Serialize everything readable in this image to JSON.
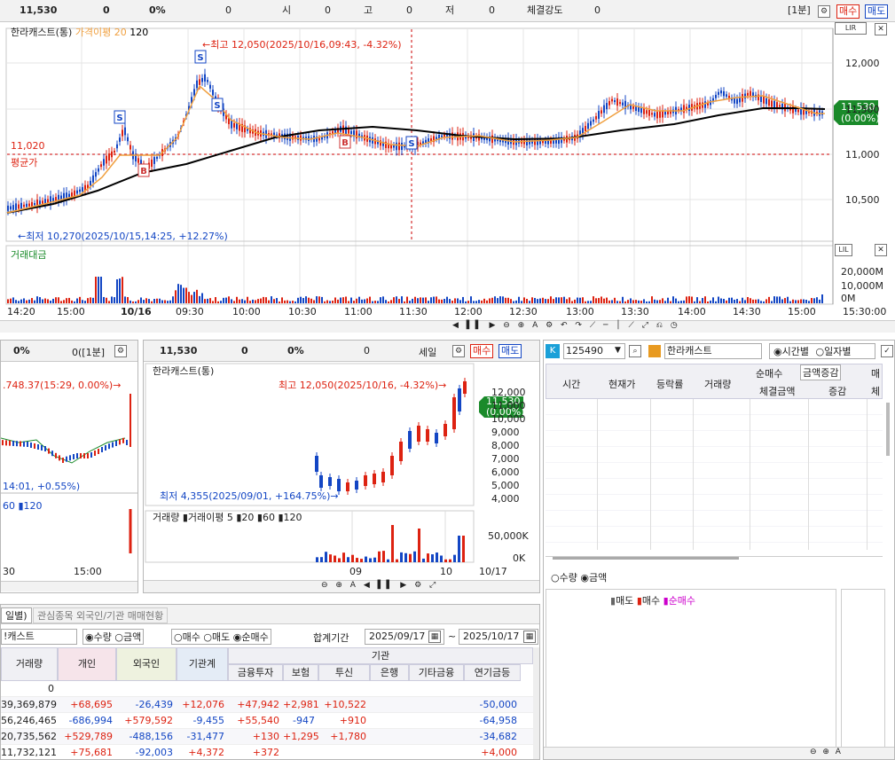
{
  "top_bar": {
    "price": "11,530",
    "change": "0",
    "rate": "0%",
    "volume": "0",
    "open_label": "시",
    "open": "0",
    "high_label": "고",
    "high": "0",
    "low_label": "저",
    "low": "0",
    "strength_label": "체결강도",
    "strength": "0",
    "interval": "[1분]",
    "buy": "매수",
    "sell": "매도"
  },
  "main_chart": {
    "legend_name": "한라캐스트(통)",
    "legend_ma": "가격이평 20",
    "legend_120": "120",
    "high_annotation": "←최고 12,050(2025/10/16,09:43, -4.32%)",
    "low_annotation": "←최저 10,270(2025/10/15,14:25, +12.27%)",
    "avg_price": "11,020",
    "avg_label": "평균가",
    "current_price": "11,530",
    "current_rate": "(0.00%)",
    "y_labels": [
      "12,000",
      "11,500",
      "11,000",
      "10,500"
    ],
    "vol_label": "거래대금",
    "vol_y_labels": [
      "20,000M",
      "10,000M",
      "0M"
    ],
    "x_labels": [
      "14:20",
      "15:00",
      "10/16",
      "09:30",
      "10:00",
      "10:30",
      "11:00",
      "11:30",
      "12:00",
      "12:30",
      "13:00",
      "13:30",
      "14:00",
      "14:30",
      "15:00",
      "15:30:00"
    ],
    "lir": "LIR",
    "lil": "LIL"
  },
  "left_panel": {
    "rate": "0%",
    "interval": "0([1분]",
    "annotation": ".748.37(15:29, 0.00%)→",
    "low_annotation": "14:01, +0.55%)",
    "legend": "60 ▮120",
    "x_labels": [
      "30",
      "15:00"
    ]
  },
  "mid_panel": {
    "price": "11,530",
    "change": "0",
    "rate": "0%",
    "volume": "0",
    "interval": "세일",
    "buy": "매수",
    "sell": "매도",
    "legend_name": "한라캐스트(통)",
    "high_annotation": "최고 12,050(2025/10/16, -4.32%)→",
    "low_annotation": "최저 4,355(2025/09/01, +164.75%)→",
    "current_price": "11,530",
    "current_rate": "(0.00%)",
    "y_labels": [
      "12,000",
      "11,000",
      "10,000",
      "9,000",
      "8,000",
      "7,000",
      "6,000",
      "5,000",
      "4,000"
    ],
    "vol_legend": "거래량 ▮거래이평 5 ▮20 ▮60 ▮120",
    "vol_y_labels": [
      "50,000K",
      "0K"
    ],
    "x_labels": [
      "09",
      "10",
      "10/17"
    ]
  },
  "right_panel": {
    "code": "125490",
    "name": "한라캐스트",
    "radio_time": "시간별",
    "radio_day": "일자별",
    "cols": [
      "시간",
      "현재가",
      "등락률",
      "거래량"
    ],
    "net_buy_label": "순매수",
    "amount_change": "금액증감",
    "buy_short": "매",
    "sub_cols": [
      "체결금액",
      "증감",
      "체"
    ],
    "radio_qty": "수량",
    "radio_amt": "금액",
    "legend_sell": "매도",
    "legend_buy": "매수",
    "legend_net": "순매수"
  },
  "bottom_panel": {
    "tab_left": "일별)",
    "tab_right": "관심종목 외국인/기관 매매현황",
    "name": "!캐스트",
    "radio_qty": "수량",
    "radio_amt": "금액",
    "radio_buy": "매수",
    "radio_sell": "매도",
    "radio_net": "순매수",
    "period_label": "합계기간",
    "date_from": "2025/09/17",
    "tilde": "~",
    "date_to": "2025/10/17",
    "headers": [
      "거래량",
      "개인",
      "외국인",
      "기관계",
      "금융투자",
      "보험",
      "투신",
      "은행",
      "기타금융",
      "연기금등"
    ],
    "inst_label": "기관",
    "rows": [
      [
        "0",
        "",
        "",
        "",
        "",
        "",
        "",
        "",
        "",
        ""
      ],
      [
        "39,369,879",
        "+68,695",
        "-26,439",
        "+12,076",
        "+47,942",
        "+2,981",
        "+10,522",
        "",
        "",
        "-50,000"
      ],
      [
        "56,246,465",
        "-686,994",
        "+579,592",
        "-9,455",
        "+55,540",
        "-947",
        "+910",
        "",
        "",
        "-64,958"
      ],
      [
        "20,735,562",
        "+529,789",
        "-488,156",
        "-31,477",
        "+130",
        "+1,295",
        "+1,780",
        "",
        "",
        "-34,682"
      ],
      [
        "11,732,121",
        "+75,681",
        "-92,003",
        "+4,372",
        "+372",
        "",
        "",
        "",
        "",
        "+4,000"
      ]
    ]
  }
}
